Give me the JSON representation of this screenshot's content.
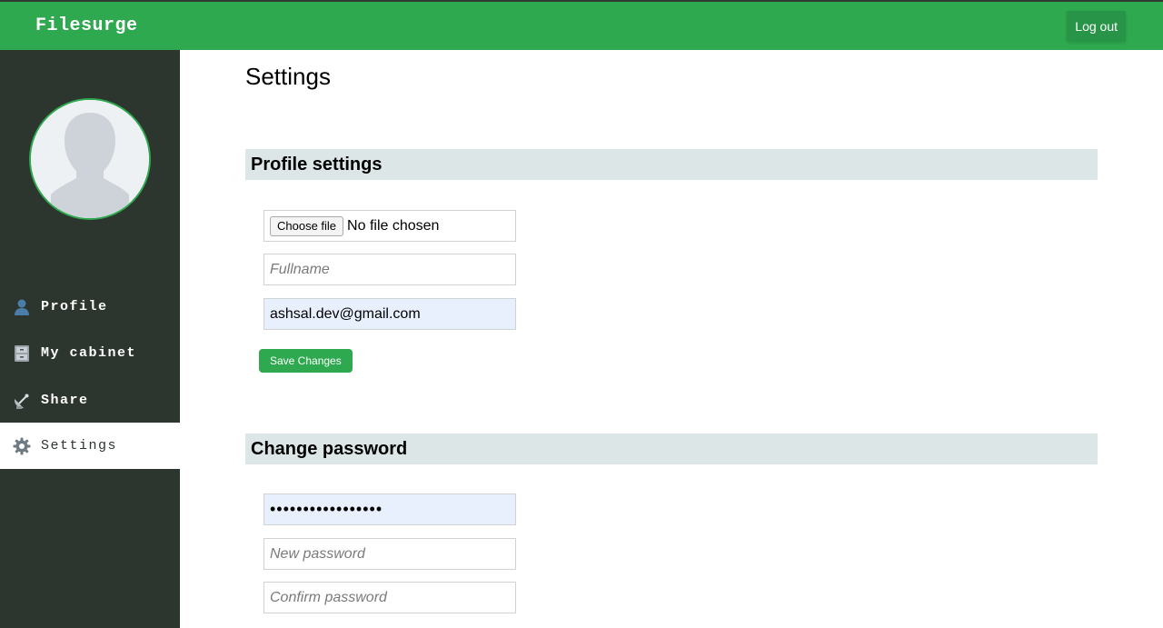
{
  "header": {
    "brand": "Filesurge",
    "logout_label": "Log out"
  },
  "sidebar": {
    "avatar_icon": "default-user-silhouette",
    "items": [
      {
        "label": "Profile",
        "icon": "bust-in-silhouette-icon",
        "active": false
      },
      {
        "label": "My cabinet",
        "icon": "file-cabinet-icon",
        "active": false
      },
      {
        "label": "Share",
        "icon": "satellite-antenna-icon",
        "active": false
      },
      {
        "label": "Settings",
        "icon": "gear-icon",
        "active": true
      }
    ]
  },
  "main": {
    "title": "Settings",
    "profile": {
      "heading": "Profile settings",
      "file_button": "Choose file",
      "file_status": "No file chosen",
      "fullname_placeholder": "Fullname",
      "email_value": "ashsal.dev@gmail.com",
      "save_label": "Save Changes"
    },
    "password": {
      "heading": "Change password",
      "current_value": "•••••••••••••••••",
      "new_placeholder": "New password",
      "confirm_placeholder": "Confirm password"
    }
  },
  "colors": {
    "brand_green": "#2ea94f",
    "sidebar_bg": "#2d352f",
    "section_head_bg": "#dde6e6",
    "autofill_bg": "#e8f0fe"
  }
}
